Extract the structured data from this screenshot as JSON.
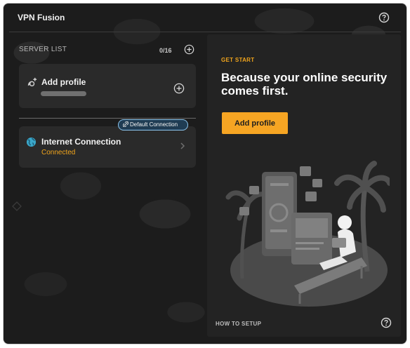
{
  "app": {
    "title": "VPN Fusion"
  },
  "server_list": {
    "label": "SERVER LIST",
    "count": "0/16"
  },
  "add_profile_card": {
    "label": "Add profile"
  },
  "connection": {
    "name": "Internet Connection",
    "status": "Connected",
    "badge": "Default Connection"
  },
  "get_started": {
    "eyebrow": "GET START",
    "headline": "Because your online security comes first.",
    "button_label": "Add profile",
    "how_to": "HOW TO SETUP"
  },
  "colors": {
    "accent": "#f6a523",
    "status_connected": "#f0a41c",
    "badge_border": "#8dc6ee",
    "badge_bg": "#1f3c53"
  },
  "icons": [
    "help-icon",
    "add-circle-icon",
    "add-profile-icon",
    "globe-icon",
    "chevron-right-icon",
    "link-icon"
  ]
}
